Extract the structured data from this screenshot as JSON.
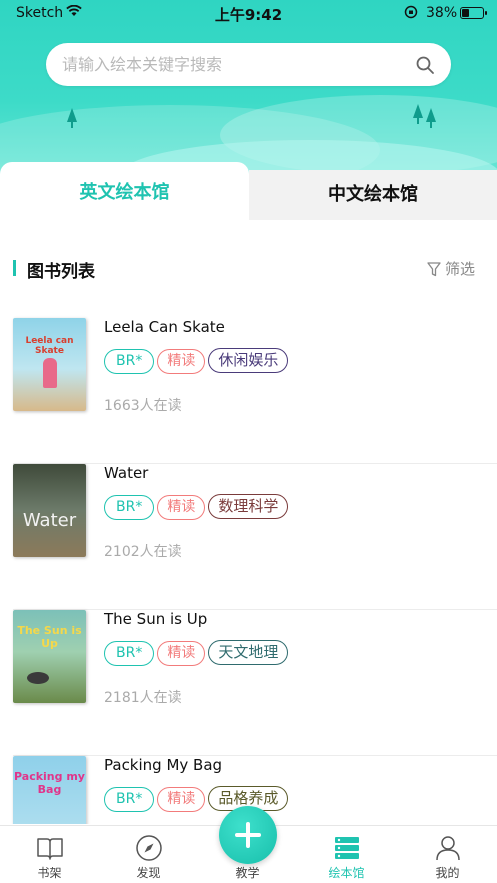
{
  "status_bar": {
    "carrier": "Sketch",
    "time": "上午9:42",
    "battery": "38%",
    "battery_level": 0.38
  },
  "search": {
    "placeholder": "请输入绘本关键字搜索"
  },
  "tabs": [
    {
      "label": "英文绘本馆",
      "active": true
    },
    {
      "label": "中文绘本馆",
      "active": false
    }
  ],
  "section": {
    "title": "图书列表",
    "filter_label": "筛选"
  },
  "books": [
    {
      "title": "Leela Can Skate",
      "level": "BR*",
      "tag1": "精读",
      "category": "休闲娱乐",
      "category_color": "#4a3b7a",
      "readers": "1663人在读",
      "cover_text": "Leela can Skate",
      "cover_color": "#8fd3e8"
    },
    {
      "title": "Water",
      "level": "BR*",
      "tag1": "精读",
      "category": "数理科学",
      "category_color": "#7a3b3b",
      "readers": "2102人在读",
      "cover_text": "Water",
      "cover_color": "#4b5a4a"
    },
    {
      "title": "The Sun is Up",
      "level": "BR*",
      "tag1": "精读",
      "category": "天文地理",
      "category_color": "#2f6b6e",
      "readers": "2181人在读",
      "cover_text": "The Sun is Up",
      "cover_color": "#7cc0b8"
    },
    {
      "title": "Packing My Bag",
      "level": "BR*",
      "tag1": "精读",
      "category": "品格养成",
      "category_color": "#5a5a2a",
      "readers": "",
      "cover_text": "Packing my Bag",
      "cover_color": "#8fd0ea"
    }
  ],
  "nav": [
    {
      "label": "书架",
      "icon": "book-icon",
      "active": false
    },
    {
      "label": "发现",
      "icon": "compass-icon",
      "active": false
    },
    {
      "label": "教学",
      "icon": "plus-icon",
      "active": false
    },
    {
      "label": "绘本馆",
      "icon": "library-icon",
      "active": true
    },
    {
      "label": "我的",
      "icon": "user-icon",
      "active": false
    }
  ],
  "colors": {
    "accent": "#1fc3b0",
    "tag_red": "#f27b7b"
  }
}
